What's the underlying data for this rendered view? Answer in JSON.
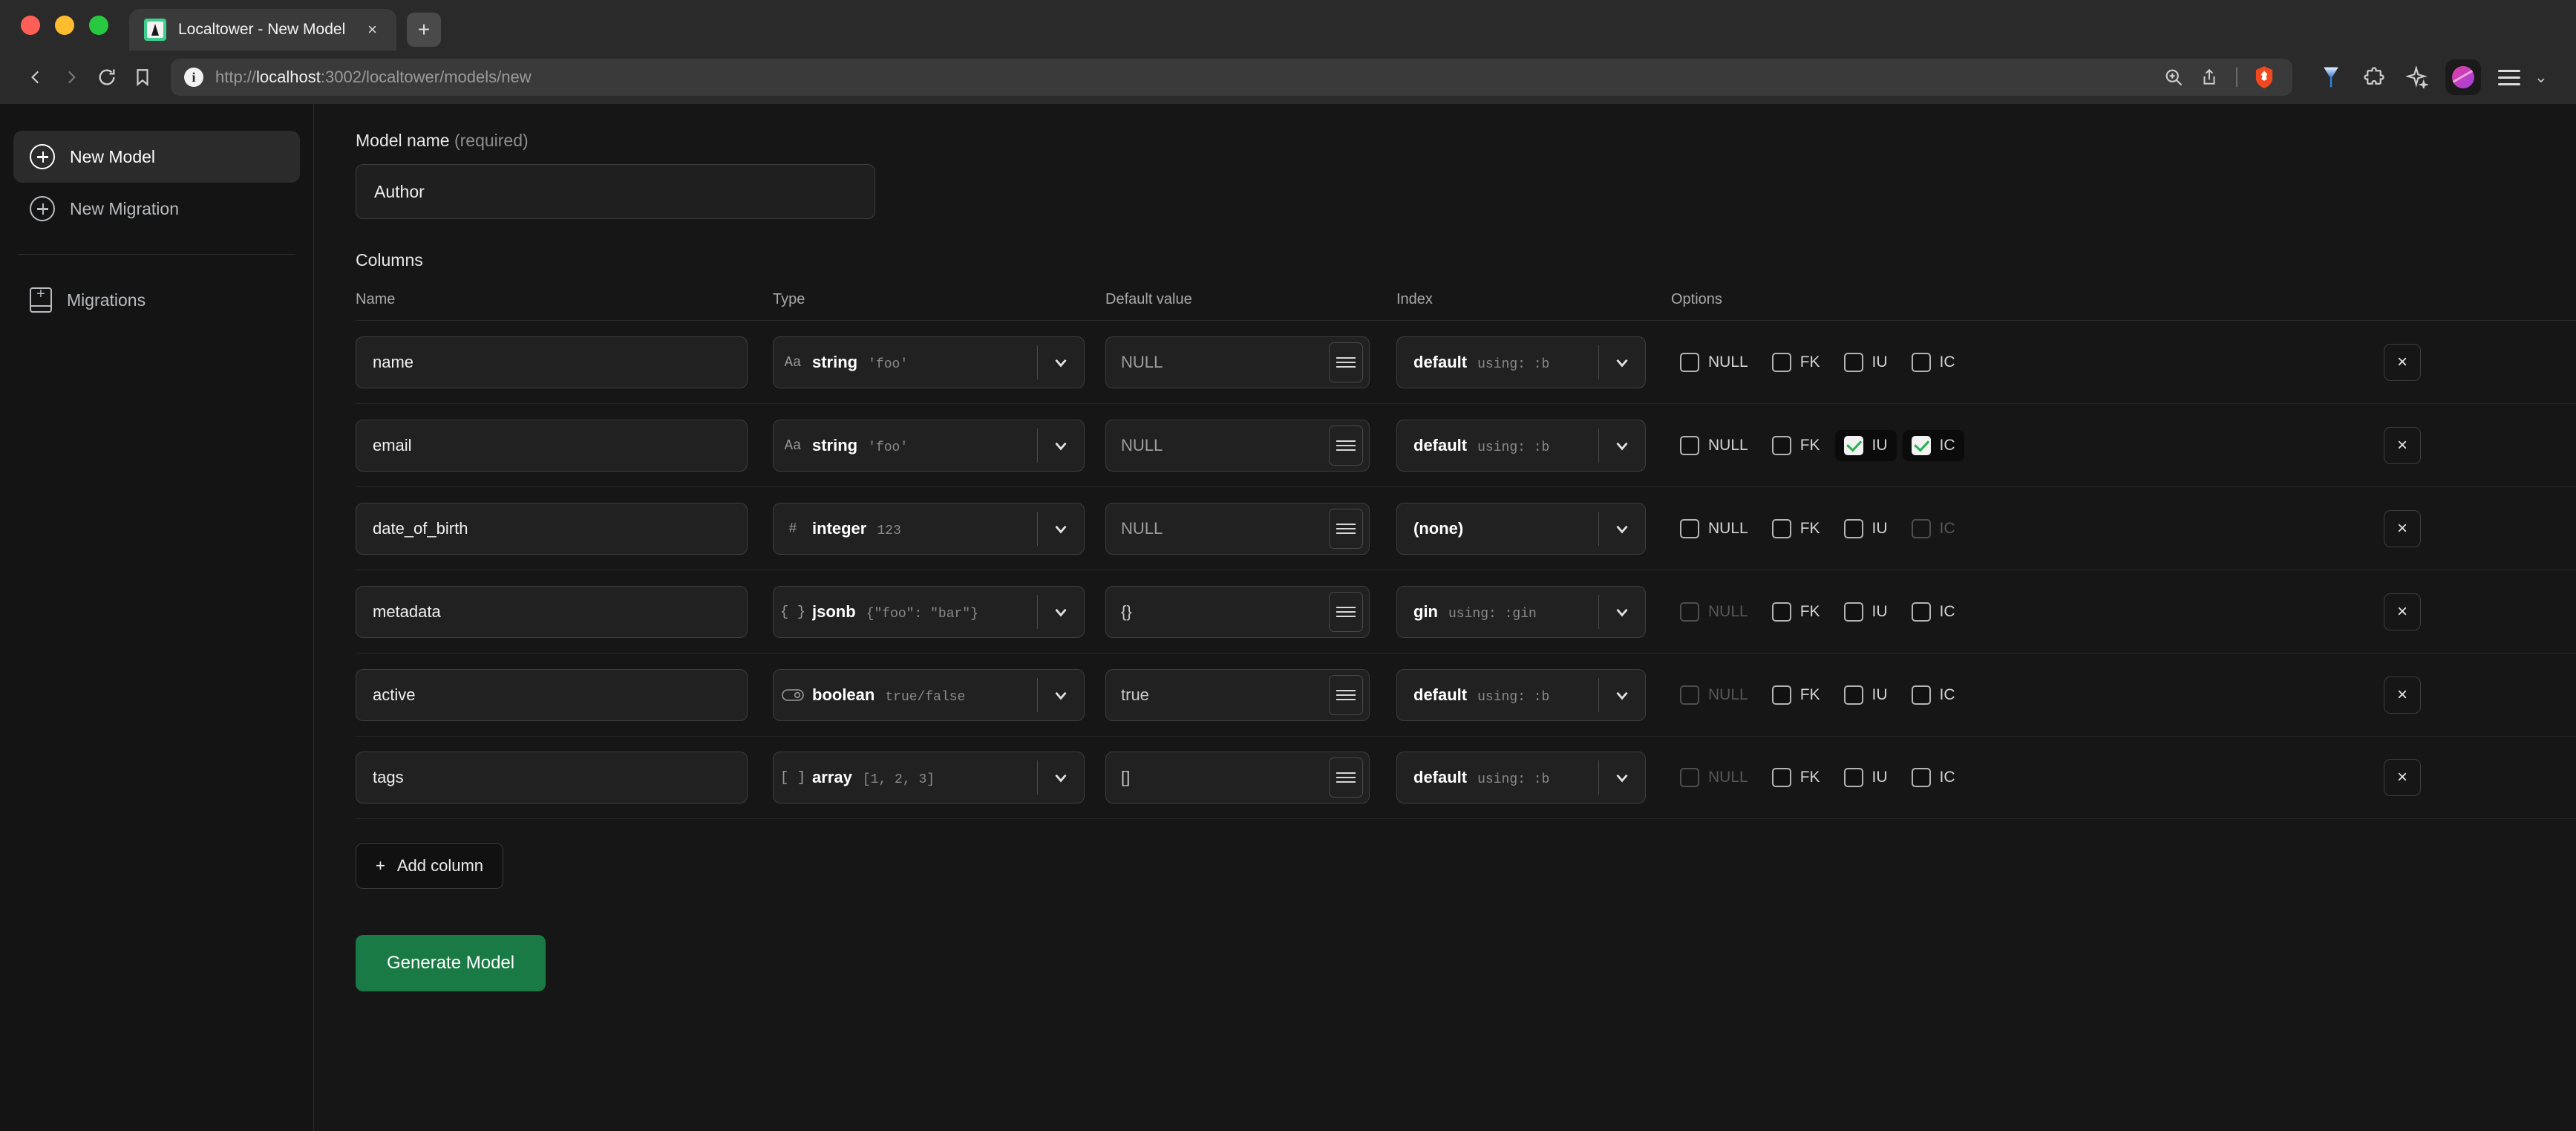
{
  "browser": {
    "tab": {
      "title": "Localtower - New Model",
      "favicon": "tower-favicon",
      "close_label": "×"
    },
    "new_tab_label": "+",
    "nav": {
      "back": "‹",
      "forward": "›",
      "reload": "⟳",
      "bookmark": "bookmark-icon"
    },
    "url": {
      "scheme": "http://",
      "host": "localhost",
      "rest": ":3002/localtower/models/new"
    },
    "toolbar_icons": [
      "zoom-search-icon",
      "share-icon",
      "brave-lion-icon",
      "vpn-icon",
      "extensions-icon",
      "leo-ai-icon",
      "profile-avatar",
      "menu-icon"
    ],
    "downloads_chevron": "⌄"
  },
  "sidebar": {
    "items": [
      {
        "label": "New Model",
        "icon": "circle-plus-icon",
        "active": true
      },
      {
        "label": "New Migration",
        "icon": "circle-plus-icon",
        "active": false
      }
    ],
    "secondary": [
      {
        "label": "Migrations",
        "icon": "book-plus-icon",
        "active": false
      }
    ]
  },
  "form": {
    "model_name_label": "Model name",
    "model_name_required_suffix": "(required)",
    "model_name_value": "Author",
    "model_name_placeholder": "Model name",
    "columns_title": "Columns",
    "headers": {
      "name": "Name",
      "type": "Type",
      "default": "Default value",
      "index": "Index",
      "options": "Options"
    },
    "add_column_label": "Add column",
    "add_column_icon": "plus-icon",
    "generate_label": "Generate Model",
    "delete_row_icon": "close-icon",
    "default_menu_icon": "list-menu-icon"
  },
  "option_labels": {
    "null": "NULL",
    "fk": "FK",
    "iu": "IU",
    "ic": "IC"
  },
  "colors": {
    "accent_green": "#1a7a45",
    "check_green": "#22b14c",
    "favicon_green": "#3ecf8e",
    "page_bg": "#161616",
    "sidebar_bg": "#141414"
  },
  "rows": [
    {
      "name": "name",
      "type": {
        "icon": "Aa",
        "icon_name": "text-type-icon",
        "name": "string",
        "example": "'foo'"
      },
      "default": {
        "value": "NULL",
        "muted": true
      },
      "index": {
        "name": "default",
        "example": "using: :b",
        "none": false
      },
      "options": {
        "null": {
          "checked": false,
          "disabled": false
        },
        "fk": {
          "checked": false,
          "disabled": false
        },
        "iu": {
          "checked": false,
          "disabled": false
        },
        "ic": {
          "checked": false,
          "disabled": false
        }
      }
    },
    {
      "name": "email",
      "type": {
        "icon": "Aa",
        "icon_name": "text-type-icon",
        "name": "string",
        "example": "'foo'"
      },
      "default": {
        "value": "NULL",
        "muted": true
      },
      "index": {
        "name": "default",
        "example": "using: :b",
        "none": false
      },
      "options": {
        "null": {
          "checked": false,
          "disabled": false
        },
        "fk": {
          "checked": false,
          "disabled": false
        },
        "iu": {
          "checked": true,
          "disabled": false
        },
        "ic": {
          "checked": true,
          "disabled": false
        }
      }
    },
    {
      "name": "date_of_birth",
      "type": {
        "icon": "#",
        "icon_name": "hash-number-icon",
        "name": "integer",
        "example": "123"
      },
      "default": {
        "value": "NULL",
        "muted": true
      },
      "index": {
        "name": "(none)",
        "example": "",
        "none": true
      },
      "options": {
        "null": {
          "checked": false,
          "disabled": false
        },
        "fk": {
          "checked": false,
          "disabled": false
        },
        "iu": {
          "checked": false,
          "disabled": false
        },
        "ic": {
          "checked": false,
          "disabled": true
        }
      }
    },
    {
      "name": "metadata",
      "type": {
        "icon": "{ }",
        "icon_name": "braces-json-icon",
        "name": "jsonb",
        "example": "{\"foo\": \"bar\"}"
      },
      "default": {
        "value": "{}",
        "muted": false
      },
      "index": {
        "name": "gin",
        "example": "using: :gin",
        "none": false
      },
      "options": {
        "null": {
          "checked": false,
          "disabled": true
        },
        "fk": {
          "checked": false,
          "disabled": false
        },
        "iu": {
          "checked": false,
          "disabled": false
        },
        "ic": {
          "checked": false,
          "disabled": false
        }
      }
    },
    {
      "name": "active",
      "type": {
        "icon": "toggle",
        "icon_name": "toggle-boolean-icon",
        "name": "boolean",
        "example": "true/false"
      },
      "default": {
        "value": "true",
        "muted": false
      },
      "index": {
        "name": "default",
        "example": "using: :b",
        "none": false
      },
      "options": {
        "null": {
          "checked": false,
          "disabled": true
        },
        "fk": {
          "checked": false,
          "disabled": false
        },
        "iu": {
          "checked": false,
          "disabled": false
        },
        "ic": {
          "checked": false,
          "disabled": false
        }
      }
    },
    {
      "name": "tags",
      "type": {
        "icon": "[ ]",
        "icon_name": "brackets-array-icon",
        "name": "array",
        "example": "[1, 2, 3]"
      },
      "default": {
        "value": "[]",
        "muted": false
      },
      "index": {
        "name": "default",
        "example": "using: :b",
        "none": false
      },
      "options": {
        "null": {
          "checked": false,
          "disabled": true
        },
        "fk": {
          "checked": false,
          "disabled": false
        },
        "iu": {
          "checked": false,
          "disabled": false
        },
        "ic": {
          "checked": false,
          "disabled": false
        }
      }
    }
  ]
}
